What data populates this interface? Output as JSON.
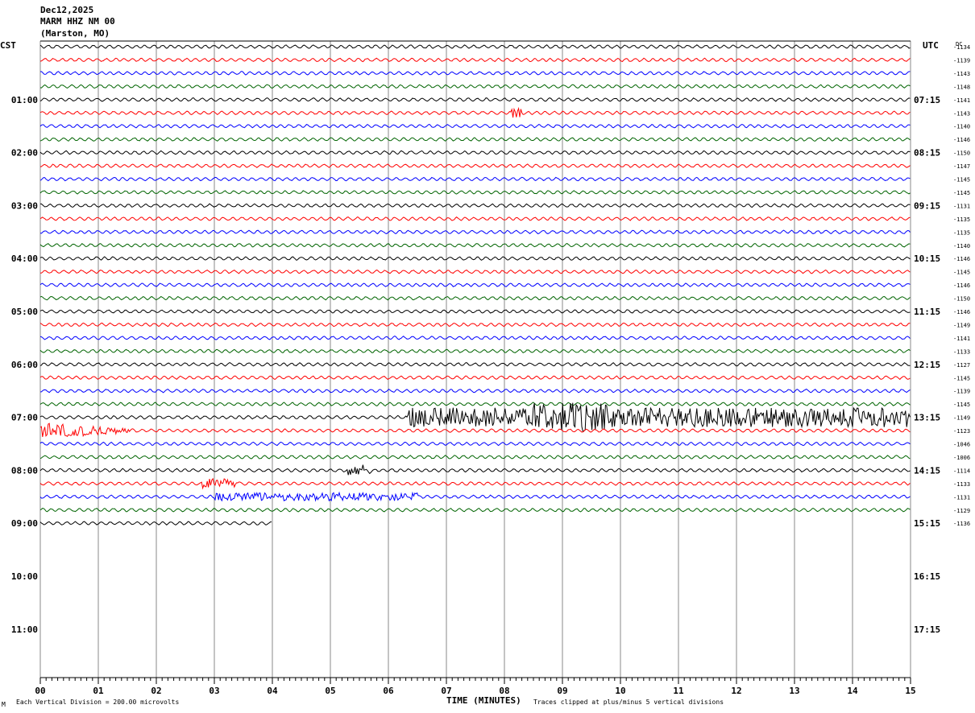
{
  "header": {
    "date": "Dec12,2025",
    "station": "MARM HHZ NM 00",
    "location": "(Marston, MO)"
  },
  "left_zone": "CST",
  "right_zone": "UTC",
  "dc_label": "DC",
  "footer": {
    "scale": "Each Vertical Division =  200.00 microvolts",
    "xlabel": "TIME (MINUTES)",
    "clip": "Traces clipped at plus/minus 5 vertical divisions",
    "corner": "M"
  },
  "chart_data": {
    "type": "line",
    "title": "",
    "xlabel": "TIME (MINUTES)",
    "xlim": [
      0,
      15
    ],
    "x_ticks": [
      "00",
      "01",
      "02",
      "03",
      "04",
      "05",
      "06",
      "07",
      "08",
      "09",
      "10",
      "11",
      "12",
      "13",
      "14",
      "15"
    ],
    "rows_per_hour": 4,
    "trace_colors": [
      "#000000",
      "#ff0000",
      "#0000ff",
      "#006400"
    ],
    "hour_labels_cst": [
      "01:00",
      "02:00",
      "03:00",
      "04:00",
      "05:00",
      "06:00",
      "07:00",
      "08:00",
      "09:00",
      "10:00",
      "11:00"
    ],
    "hour_labels_utc": [
      "07:15",
      "08:15",
      "09:15",
      "10:15",
      "11:15",
      "12:15",
      "13:15",
      "14:15",
      "15:15",
      "16:15",
      "17:15"
    ],
    "dc_offsets": [
      "-1134",
      "-1139",
      "-1143",
      "-1148",
      "-1141",
      "-1143",
      "-1140",
      "-1146",
      "-1150",
      "-1147",
      "-1145",
      "-1145",
      "-1131",
      "-1135",
      "-1135",
      "-1140",
      "-1146",
      "-1145",
      "-1146",
      "-1150",
      "-1146",
      "-1149",
      "-1141",
      "-1133",
      "-1127",
      "-1145",
      "-1139",
      "-1145",
      "-1149",
      "-1123",
      "-1046",
      "-1006",
      "-1114",
      "-1133",
      "-1131",
      "-1129",
      "-1136"
    ],
    "trace_count": 37,
    "last_trace_end_minute": 4,
    "events": [
      {
        "row": 5,
        "start_min": 8.1,
        "end_min": 8.3,
        "amp": 6
      },
      {
        "row": 28,
        "start_min": 6.3,
        "end_min": 15,
        "amp": 12
      },
      {
        "row": 28,
        "start_min": 8.5,
        "end_min": 9.8,
        "amp": 18
      },
      {
        "row": 29,
        "start_min": 0,
        "end_min": 2.2,
        "amp": 10
      },
      {
        "row": 32,
        "start_min": 5.3,
        "end_min": 5.7,
        "amp": 7
      },
      {
        "row": 33,
        "start_min": 2.8,
        "end_min": 3.4,
        "amp": 6
      },
      {
        "row": 34,
        "start_min": 3.0,
        "end_min": 6.5,
        "amp": 5
      }
    ]
  }
}
